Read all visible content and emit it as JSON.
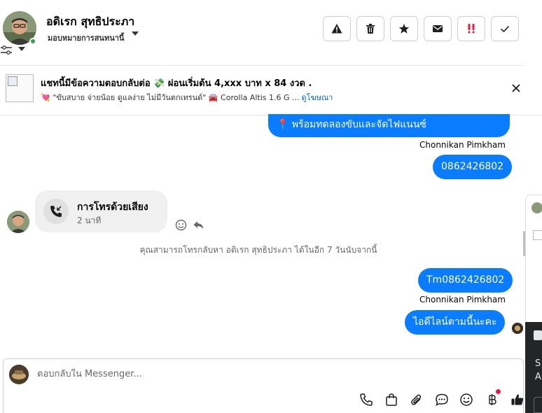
{
  "header": {
    "contact_name": "อดิเรก สุทธิประภา",
    "assign_label": "มอบหมายการสนทนานี้",
    "buttons": [
      {
        "name": "report-button",
        "icon": "warning-icon"
      },
      {
        "name": "delete-button",
        "icon": "trash-icon"
      },
      {
        "name": "star-button",
        "icon": "star-icon"
      },
      {
        "name": "mark-unread-button",
        "icon": "envelope-icon"
      },
      {
        "name": "spam-button",
        "icon": "exclamation-icon"
      },
      {
        "name": "done-button",
        "icon": "check-icon"
      }
    ]
  },
  "ad": {
    "title": "แชทนี้มีข้อความตอบกลับต่อ 💸 ผ่อนเริ่มต้น 4,xxx บาท x 84 งวด .",
    "subtitle": "💘 \"ขับสบาย จ่ายน้อย ดูแลง่าย ไม่มีวันตกเทรนด์\" 🚘 Corolla Altis 1.6 G ...",
    "link": "ดูโฆษณา"
  },
  "messages": {
    "msg1": "📍 พร้อมทดลองขับและจัดไฟแนนซ์",
    "sender1": "Chonnikan Pimkham",
    "msg2": "0862426802",
    "call_title": "การโทรด้วยเสียง",
    "call_duration": "2 นาที",
    "notice": "คุณสามารถโทรกลับหา อดิเรก สุทธิประภา ได้ในอีก 7 วันนับจากนี้",
    "msg3": "Tm0862426802",
    "sender2": "Chonnikan Pimkham",
    "msg4": "ไอดีไลน์ตามนี้นะคะ"
  },
  "reply": {
    "placeholder": "ตอบกลับใน Messenger..."
  },
  "edge": {
    "text1": "S",
    "text2": "A"
  },
  "colors": {
    "accent": "#0a7cff",
    "link": "#0064d1",
    "spam": "#e41e3f"
  }
}
